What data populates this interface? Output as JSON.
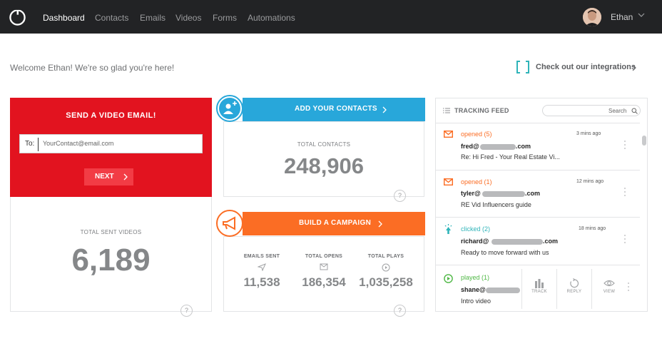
{
  "nav": {
    "items": [
      {
        "label": "Dashboard",
        "active": true
      },
      {
        "label": "Contacts",
        "active": false
      },
      {
        "label": "Emails",
        "active": false
      },
      {
        "label": "Videos",
        "active": false
      },
      {
        "label": "Forms",
        "active": false
      },
      {
        "label": "Automations",
        "active": false
      }
    ],
    "user_name": "Ethan"
  },
  "welcome": "Welcome Ethan! We're so glad you're here!",
  "integrations_link": "Check out our integrations",
  "send_video": {
    "title": "SEND A VIDEO EMAIL!",
    "to_label": "To:",
    "to_placeholder": "YourContact@email.com",
    "next_label": "NEXT",
    "total_label": "TOTAL SENT VIDEOS",
    "total_value": "6,189"
  },
  "contacts": {
    "banner": "ADD YOUR CONTACTS",
    "total_label": "TOTAL CONTACTS",
    "total_value": "248,906"
  },
  "campaign": {
    "banner": "BUILD A CAMPAIGN",
    "stats": [
      {
        "label": "EMAILS SENT",
        "value": "11,538",
        "icon": "send-icon"
      },
      {
        "label": "TOTAL OPENS",
        "value": "186,354",
        "icon": "envelope-icon"
      },
      {
        "label": "TOTAL PLAYS",
        "value": "1,035,258",
        "icon": "play-icon"
      }
    ]
  },
  "feed": {
    "title": "TRACKING FEED",
    "search_placeholder": "Search",
    "items": [
      {
        "status": "opened (5)",
        "email_prefix": "fred@",
        "email_suffix": ".com",
        "subject": "Re: Hi Fred - Your Real Estate Vi...",
        "time": "3 mins ago",
        "icon": "envelope-icon"
      },
      {
        "status": "opened (1)",
        "email_prefix": "tyler@",
        "email_suffix": ".com",
        "subject": "RE Vid Influencers guide",
        "time": "12 mins ago",
        "icon": "envelope-icon"
      },
      {
        "status": "clicked (2)",
        "email_prefix": "richard@",
        "email_suffix": ".com",
        "subject": "Ready to move forward with us",
        "time": "18 mins ago",
        "icon": "click-icon"
      },
      {
        "status": "played (1)",
        "email_prefix": "shane@",
        "email_suffix": "",
        "subject": "Intro video",
        "time": "",
        "icon": "play-icon"
      }
    ],
    "actions": [
      "TRACK",
      "REPLY",
      "VIEW"
    ]
  },
  "help_glyph": "?",
  "colors": {
    "nav_bg": "#222325",
    "red": "#e2131f",
    "blue": "#28a7da",
    "orange": "#fb6d24",
    "teal": "#2fb4b9",
    "green": "#4fb845"
  }
}
